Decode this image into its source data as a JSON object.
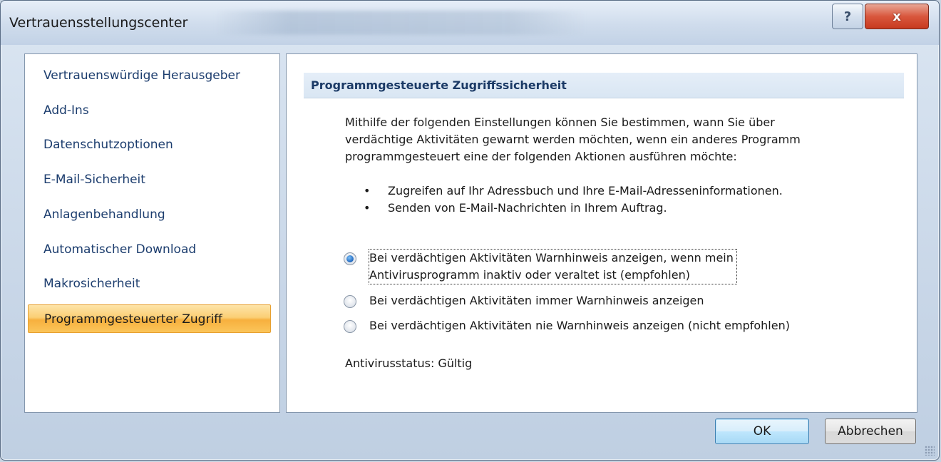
{
  "window": {
    "title": "Vertrauensstellungscenter",
    "help_label": "?",
    "close_label": "x"
  },
  "sidebar": {
    "items": [
      {
        "label": "Vertrauenswürdige Herausgeber",
        "active": false
      },
      {
        "label": "Add-Ins",
        "active": false
      },
      {
        "label": "Datenschutzoptionen",
        "active": false
      },
      {
        "label": "E-Mail-Sicherheit",
        "active": false
      },
      {
        "label": "Anlagenbehandlung",
        "active": false
      },
      {
        "label": "Automatischer Download",
        "active": false
      },
      {
        "label": "Makrosicherheit",
        "active": false
      },
      {
        "label": "Programmgesteuerter Zugriff",
        "active": true
      }
    ]
  },
  "main": {
    "section_title": "Programmgesteuerte Zugriffssicherheit",
    "description_lines": [
      "Mithilfe der folgenden Einstellungen können Sie bestimmen, wann Sie über",
      "verdächtige Aktivitäten gewarnt werden möchten, wenn ein anderes Programm",
      "programmgesteuert eine der folgenden Aktionen ausführen möchte:"
    ],
    "bullets": [
      "Zugreifen auf Ihr Adressbuch und Ihre E-Mail-Adresseninformationen.",
      "Senden von E-Mail-Nachrichten in Ihrem Auftrag."
    ],
    "options": [
      {
        "line1": "Bei verdächtigen Aktivitäten Warnhinweis anzeigen, wenn mein",
        "line2": "Antivirusprogramm inaktiv oder veraltet ist (empfohlen)",
        "checked": true
      },
      {
        "line1": "Bei verdächtigen Aktivitäten immer Warnhinweis anzeigen",
        "line2": "",
        "checked": false
      },
      {
        "line1": "Bei verdächtigen Aktivitäten nie Warnhinweis anzeigen (nicht empfohlen)",
        "line2": "",
        "checked": false
      }
    ],
    "status": "Antivirusstatus: Gültig"
  },
  "footer": {
    "ok_label": "OK",
    "cancel_label": "Abbrechen"
  }
}
